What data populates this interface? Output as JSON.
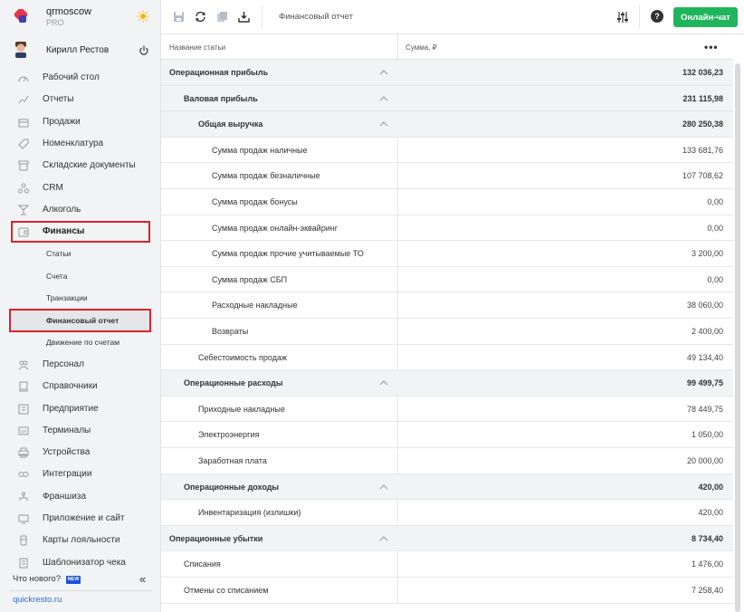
{
  "brand": {
    "name": "qrmoscow",
    "plan": "PRO"
  },
  "user": {
    "name": "Кирилл Рестов"
  },
  "nav": [
    {
      "label": "Рабочий стол",
      "icon": "dashboard-icon"
    },
    {
      "label": "Отчеты",
      "icon": "reports-icon"
    },
    {
      "label": "Продажи",
      "icon": "sales-icon"
    },
    {
      "label": "Номенклатура",
      "icon": "tag-icon"
    },
    {
      "label": "Складские документы",
      "icon": "warehouse-icon"
    },
    {
      "label": "CRM",
      "icon": "crm-icon"
    },
    {
      "label": "Алкоголь",
      "icon": "glass-icon"
    },
    {
      "label": "Финансы",
      "icon": "wallet-icon"
    },
    {
      "label": "Статьи"
    },
    {
      "label": "Счета"
    },
    {
      "label": "Транзакции"
    },
    {
      "label": "Финансовый отчет"
    },
    {
      "label": "Движение по счетам"
    },
    {
      "label": "Персонал",
      "icon": "staff-icon"
    },
    {
      "label": "Справочники",
      "icon": "book-icon"
    },
    {
      "label": "Предприятие",
      "icon": "building-icon"
    },
    {
      "label": "Терминалы",
      "icon": "terminal-icon"
    },
    {
      "label": "Устройства",
      "icon": "printer-icon"
    },
    {
      "label": "Интеграции",
      "icon": "integration-icon"
    },
    {
      "label": "Франшиза",
      "icon": "franchise-icon"
    },
    {
      "label": "Приложение и сайт",
      "icon": "app-icon"
    },
    {
      "label": "Карты лояльности",
      "icon": "card-icon"
    },
    {
      "label": "Шаблонизатор чека",
      "icon": "receipt-icon"
    }
  ],
  "footer": {
    "news": "Что нового?",
    "badge": "NEW",
    "collapse": "«",
    "site": "quickresto.ru"
  },
  "toolbar": {
    "title": "Финансовый отчет",
    "chat": "Онлайн-чат",
    "help": "?"
  },
  "table": {
    "col_name": "Название статьи",
    "col_sum": "Сумма, ₽",
    "more": "•••",
    "rows": [
      {
        "name": "Операционная прибыль",
        "value": "132 036,23",
        "level": 0,
        "group": true
      },
      {
        "name": "Валовая прибыль",
        "value": "231 115,98",
        "level": 1,
        "group": true
      },
      {
        "name": "Общая выручка",
        "value": "280 250,38",
        "level": 2,
        "group": true
      },
      {
        "name": "Сумма продаж наличные",
        "value": "133 681,76",
        "level": 3,
        "group": false
      },
      {
        "name": "Сумма продаж безналичные",
        "value": "107 708,62",
        "level": 3,
        "group": false
      },
      {
        "name": "Сумма продаж бонусы",
        "value": "0,00",
        "level": 3,
        "group": false
      },
      {
        "name": "Сумма продаж онлайн-эквайринг",
        "value": "0,00",
        "level": 3,
        "group": false
      },
      {
        "name": "Сумма продаж прочие учитываемые ТО",
        "value": "3 200,00",
        "level": 3,
        "group": false
      },
      {
        "name": "Сумма продаж СБП",
        "value": "0,00",
        "level": 3,
        "group": false
      },
      {
        "name": "Расходные накладные",
        "value": "38 060,00",
        "level": 3,
        "group": false
      },
      {
        "name": "Возвраты",
        "value": "2 400,00",
        "level": 3,
        "group": false
      },
      {
        "name": "Себестоимость продаж",
        "value": "49 134,40",
        "level": 2,
        "group": false
      },
      {
        "name": "Операционные расходы",
        "value": "99 499,75",
        "level": 1,
        "group": true
      },
      {
        "name": "Приходные накладные",
        "value": "78 449,75",
        "level": 2,
        "group": false
      },
      {
        "name": "Электроэнергия",
        "value": "1 050,00",
        "level": 2,
        "group": false
      },
      {
        "name": "Заработная плата",
        "value": "20 000,00",
        "level": 2,
        "group": false
      },
      {
        "name": "Операционные доходы",
        "value": "420,00",
        "level": 1,
        "group": true
      },
      {
        "name": "Инвентаризация (излишки)",
        "value": "420,00",
        "level": 2,
        "group": false
      },
      {
        "name": "Операционные убытки",
        "value": "8 734,40",
        "level": 0,
        "group": true
      },
      {
        "name": "Списания",
        "value": "1 476,00",
        "level": 1,
        "group": false
      },
      {
        "name": "Отмены со списанием",
        "value": "7 258,40",
        "level": 1,
        "group": false
      }
    ]
  },
  "colors": {
    "accent_green": "#20b55c",
    "highlight_red": "#d9232d",
    "link_blue": "#2a6fd6"
  }
}
